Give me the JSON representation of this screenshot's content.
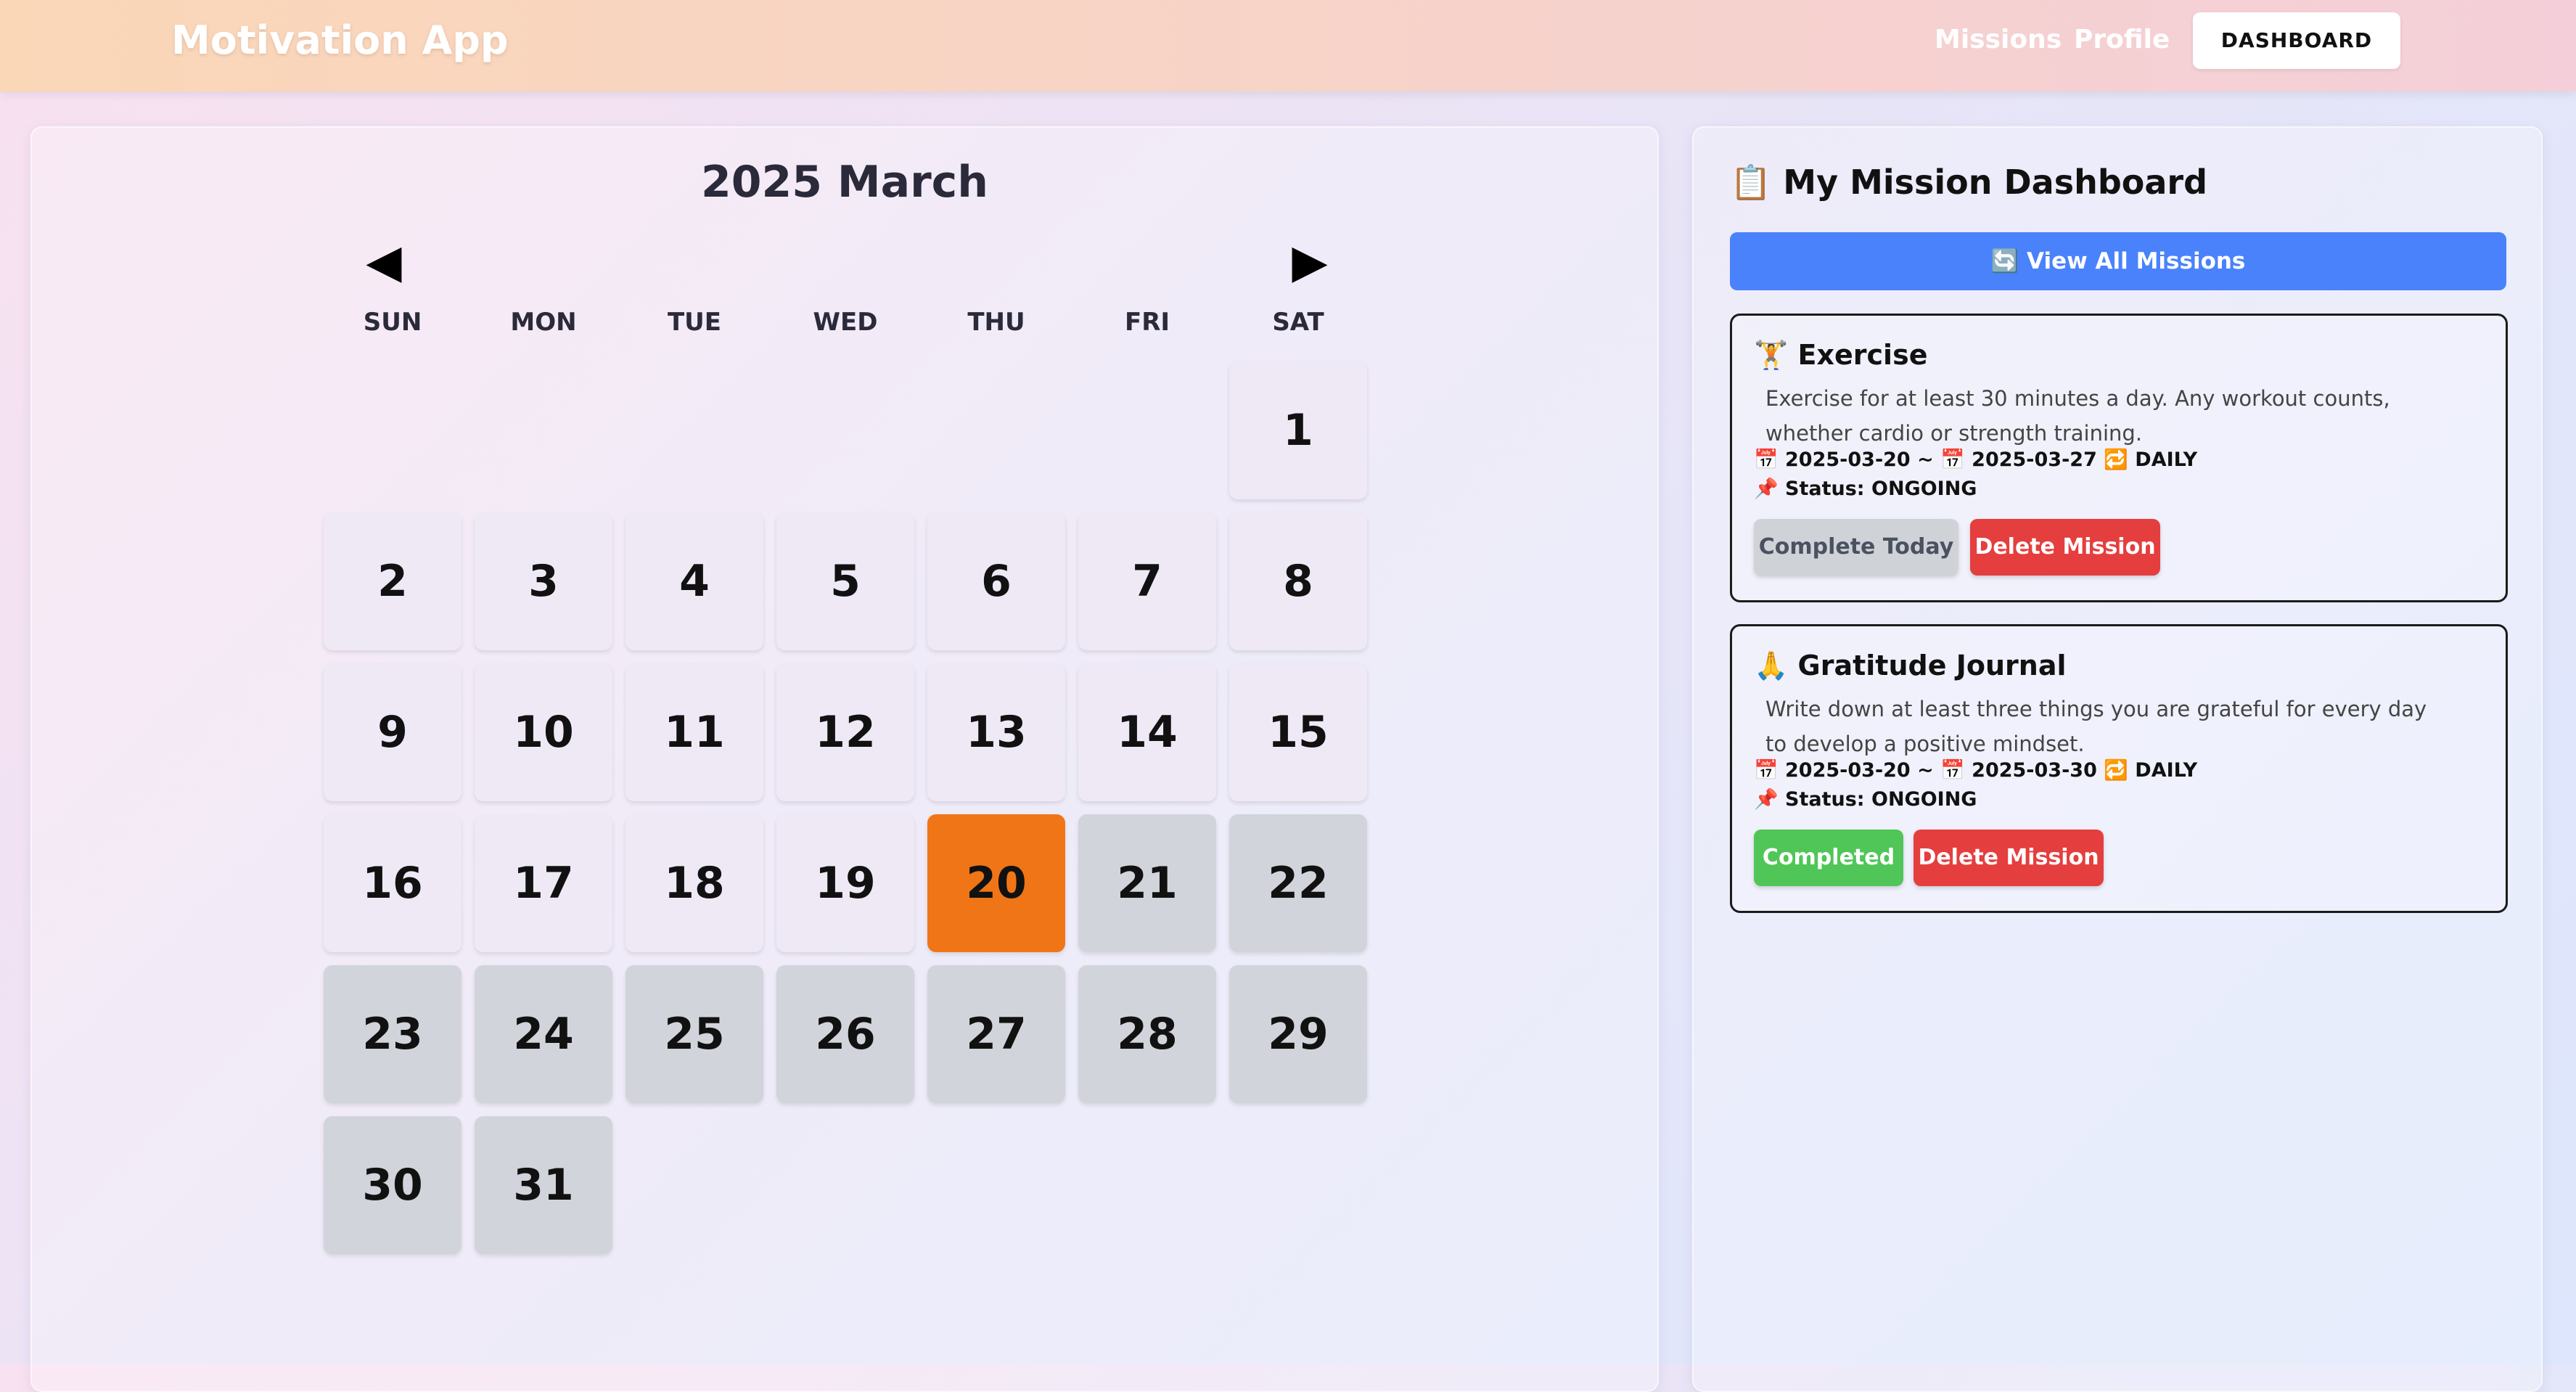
{
  "header": {
    "brand": "Motivation App",
    "nav": {
      "missions": "Missions",
      "profile": "Profile",
      "dashboard": "DASHBOARD"
    }
  },
  "calendar": {
    "title": "2025 March",
    "prev_arrow": "◀",
    "next_arrow": "▶",
    "weekdays": [
      "SUN",
      "MON",
      "TUE",
      "WED",
      "THU",
      "FRI",
      "SAT"
    ],
    "first_weekday_index": 6,
    "days_in_month": 31,
    "today": 20,
    "past_range_start": 21
  },
  "dashboard": {
    "title": "📋 My Mission Dashboard",
    "view_all": "🔄 View All Missions",
    "missions": [
      {
        "name": "🏋️ Exercise",
        "description": "Exercise for at least 30 minutes a day. Any workout counts, whether cardio or strength training.",
        "dates": "📅 2025-03-20 ~ 📅 2025-03-27 🔁 DAILY",
        "status": "📌 Status: ONGOING",
        "primary_button": "Complete Today",
        "delete_button": "Delete Mission"
      },
      {
        "name": "🙏 Gratitude Journal",
        "description": "Write down at least three things you are grateful for every day to develop a positive mindset.",
        "dates": "📅 2025-03-20 ~ 📅 2025-03-30 🔁 DAILY",
        "status": "📌 Status: ONGOING",
        "primary_button": "Completed",
        "delete_button": "Delete Mission"
      }
    ]
  },
  "colors": {
    "today": "#f07516",
    "day": "#efe9f6",
    "past_day": "#d1d4da",
    "view_all": "#4a82fb",
    "completed": "#4fc657",
    "delete": "#e53e3e"
  }
}
